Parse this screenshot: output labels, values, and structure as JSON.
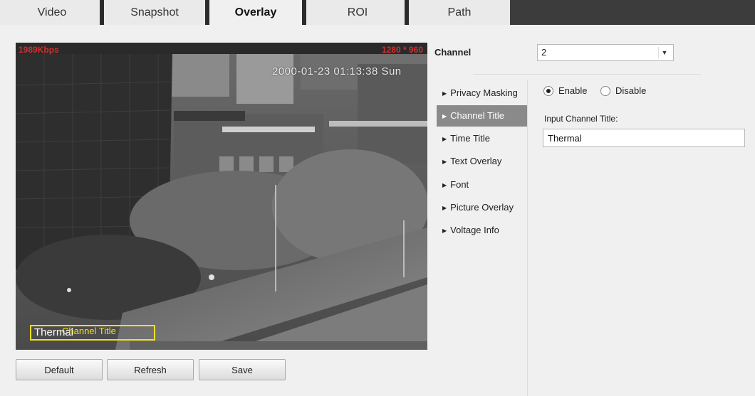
{
  "tabs": [
    {
      "label": "Video"
    },
    {
      "label": "Snapshot"
    },
    {
      "label": "Overlay",
      "active": true
    },
    {
      "label": "ROI"
    },
    {
      "label": "Path"
    }
  ],
  "preview": {
    "bitrate": "1989Kbps",
    "resolution": "1280 * 960",
    "timestamp": "2000-01-23 01:13:38 Sun",
    "channel_title_text": "Thermal",
    "channel_title_box_label": "Channel Title"
  },
  "buttons": {
    "default": "Default",
    "refresh": "Refresh",
    "save": "Save"
  },
  "channel": {
    "label": "Channel",
    "selected": "2"
  },
  "menu": [
    {
      "label": "Privacy Masking"
    },
    {
      "label": "Channel Title",
      "active": true
    },
    {
      "label": "Time Title"
    },
    {
      "label": "Text Overlay"
    },
    {
      "label": "Font"
    },
    {
      "label": "Picture Overlay"
    },
    {
      "label": "Voltage Info"
    }
  ],
  "settings": {
    "enable_label": "Enable",
    "disable_label": "Disable",
    "enabled": true,
    "input_label": "Input Channel Title:",
    "input_value": "Thermal"
  },
  "colors": {
    "osd_red": "#d03030",
    "overlay_box_yellow": "#f0e020",
    "active_menu_bg": "#8a8a8a"
  }
}
